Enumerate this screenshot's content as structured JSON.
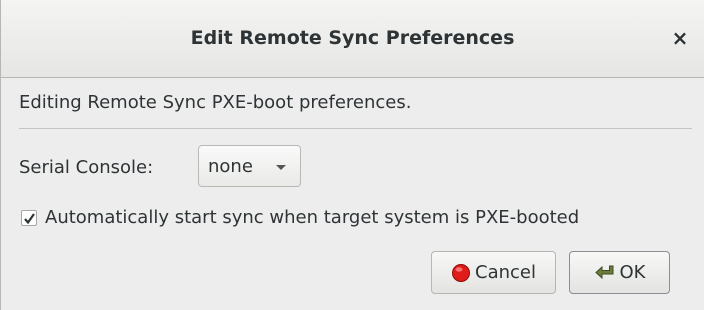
{
  "dialog": {
    "title": "Edit Remote Sync Preferences",
    "close_glyph": "×",
    "description": "Editing Remote Sync PXE-boot preferences."
  },
  "serial_console": {
    "label": "Serial Console:",
    "selected": "none"
  },
  "auto_sync": {
    "label": "Automatically start sync when target system is PXE-booted",
    "checked": true
  },
  "buttons": {
    "cancel_label": "Cancel",
    "cancel_icon": "red-circle-icon",
    "ok_label": "OK",
    "ok_icon": "return-arrow-icon"
  },
  "colors": {
    "cancel_icon": "#e01b1b",
    "ok_icon": "#6b7d3b"
  }
}
